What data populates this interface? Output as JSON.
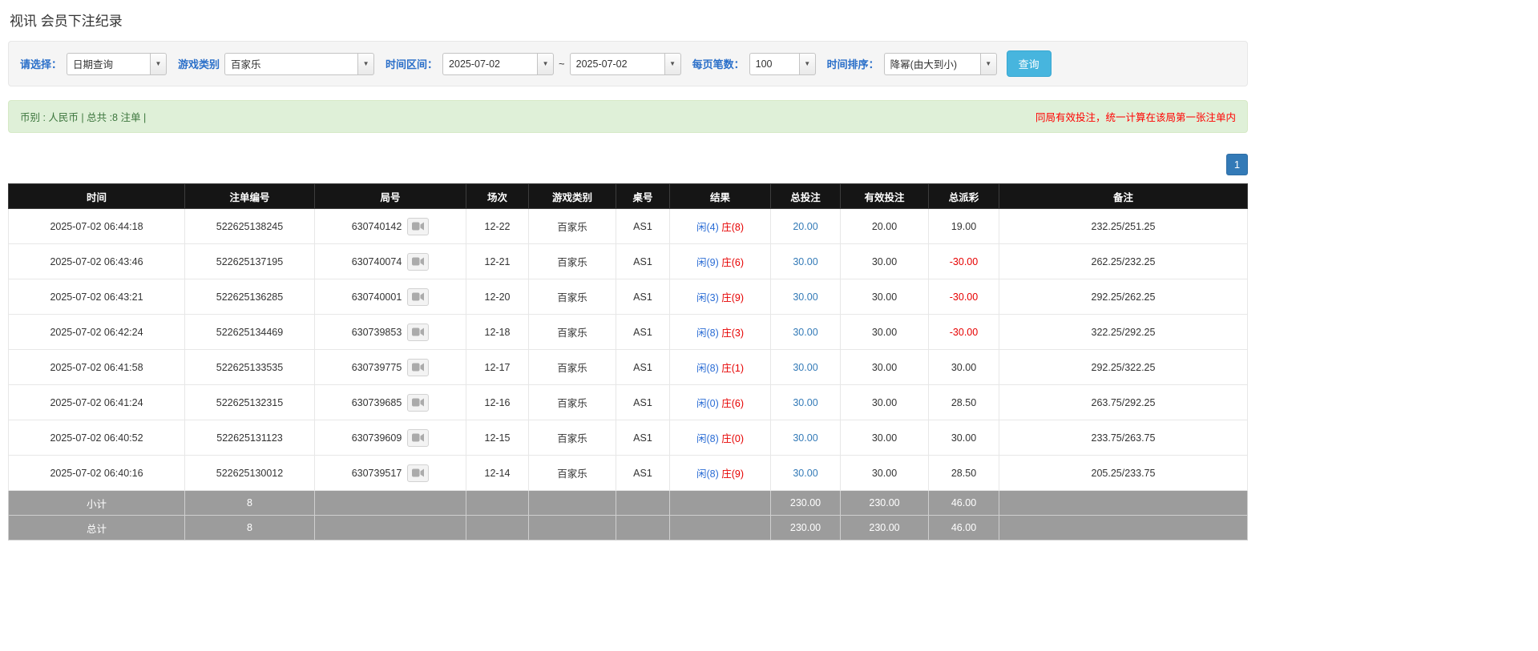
{
  "page": {
    "title": "视讯 会员下注纪录"
  },
  "filters": {
    "select_label": "请选择：",
    "select_value": "日期查询",
    "game_type_label": "游戏类别",
    "game_type_value": "百家乐",
    "time_range_label": "时间区间：",
    "date_from": "2025-07-02",
    "tilde": "~",
    "date_to": "2025-07-02",
    "page_size_label": "每页笔数：",
    "page_size_value": "100",
    "sort_label": "时间排序：",
    "sort_value": "降幂(由大到小)",
    "search_button": "查询"
  },
  "summary": {
    "left_text": "币别 : 人民币 | 总共 :8 注单 |",
    "right_note": "同局有效投注，统一计算在该局第一张注单内"
  },
  "pagination": {
    "current": "1"
  },
  "icons": {
    "combo_arrow": "▼",
    "video_icon_name": "video-replay-icon"
  },
  "colors": {
    "header_bg": "#151515",
    "footer_bg": "#9c9c9c",
    "accent_blue": "#337ab7",
    "label_blue": "#2a6fc9",
    "negative_red": "#e60000",
    "success_bg": "#dff0d8",
    "search_button_bg": "#47b5de"
  },
  "table": {
    "headers": [
      "时间",
      "注单编号",
      "局号",
      "场次",
      "游戏类别",
      "桌号",
      "结果",
      "总投注",
      "有效投注",
      "总派彩",
      "备注"
    ],
    "rows": [
      {
        "time": "2025-07-02 06:44:18",
        "bet_id": "522625138245",
        "round_id": "630740142",
        "session": "12-22",
        "game": "百家乐",
        "table_no": "AS1",
        "player": "闲(4)",
        "banker": "庄(8)",
        "total_bet": "20.00",
        "valid_bet": "20.00",
        "payout": "19.00",
        "remark": "232.25/251.25"
      },
      {
        "time": "2025-07-02 06:43:46",
        "bet_id": "522625137195",
        "round_id": "630740074",
        "session": "12-21",
        "game": "百家乐",
        "table_no": "AS1",
        "player": "闲(9)",
        "banker": "庄(6)",
        "total_bet": "30.00",
        "valid_bet": "30.00",
        "payout": "-30.00",
        "remark": "262.25/232.25"
      },
      {
        "time": "2025-07-02 06:43:21",
        "bet_id": "522625136285",
        "round_id": "630740001",
        "session": "12-20",
        "game": "百家乐",
        "table_no": "AS1",
        "player": "闲(3)",
        "banker": "庄(9)",
        "total_bet": "30.00",
        "valid_bet": "30.00",
        "payout": "-30.00",
        "remark": "292.25/262.25"
      },
      {
        "time": "2025-07-02 06:42:24",
        "bet_id": "522625134469",
        "round_id": "630739853",
        "session": "12-18",
        "game": "百家乐",
        "table_no": "AS1",
        "player": "闲(8)",
        "banker": "庄(3)",
        "total_bet": "30.00",
        "valid_bet": "30.00",
        "payout": "-30.00",
        "remark": "322.25/292.25"
      },
      {
        "time": "2025-07-02 06:41:58",
        "bet_id": "522625133535",
        "round_id": "630739775",
        "session": "12-17",
        "game": "百家乐",
        "table_no": "AS1",
        "player": "闲(8)",
        "banker": "庄(1)",
        "total_bet": "30.00",
        "valid_bet": "30.00",
        "payout": "30.00",
        "remark": "292.25/322.25"
      },
      {
        "time": "2025-07-02 06:41:24",
        "bet_id": "522625132315",
        "round_id": "630739685",
        "session": "12-16",
        "game": "百家乐",
        "table_no": "AS1",
        "player": "闲(0)",
        "banker": "庄(6)",
        "total_bet": "30.00",
        "valid_bet": "30.00",
        "payout": "28.50",
        "remark": "263.75/292.25"
      },
      {
        "time": "2025-07-02 06:40:52",
        "bet_id": "522625131123",
        "round_id": "630739609",
        "session": "12-15",
        "game": "百家乐",
        "table_no": "AS1",
        "player": "闲(8)",
        "banker": "庄(0)",
        "total_bet": "30.00",
        "valid_bet": "30.00",
        "payout": "30.00",
        "remark": "233.75/263.75"
      },
      {
        "time": "2025-07-02 06:40:16",
        "bet_id": "522625130012",
        "round_id": "630739517",
        "session": "12-14",
        "game": "百家乐",
        "table_no": "AS1",
        "player": "闲(8)",
        "banker": "庄(9)",
        "total_bet": "30.00",
        "valid_bet": "30.00",
        "payout": "28.50",
        "remark": "205.25/233.75"
      }
    ],
    "subtotal": {
      "label": "小计",
      "count": "8",
      "total_bet": "230.00",
      "valid_bet": "230.00",
      "payout": "46.00"
    },
    "total": {
      "label": "总计",
      "count": "8",
      "total_bet": "230.00",
      "valid_bet": "230.00",
      "payout": "46.00"
    }
  }
}
